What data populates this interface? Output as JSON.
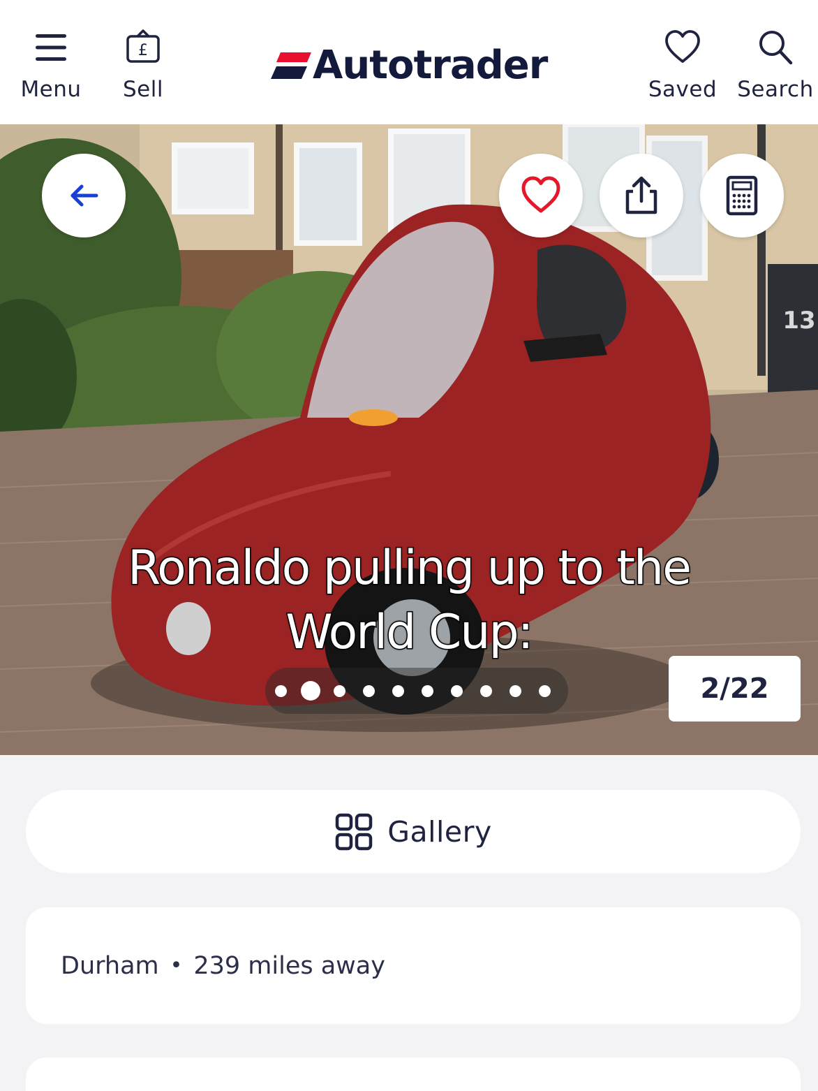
{
  "header": {
    "menu_label": "Menu",
    "sell_label": "Sell",
    "logo_text": "Autotrader",
    "saved_label": "Saved",
    "search_label": "Search",
    "icons": {
      "menu": "hamburger-menu-icon",
      "sell": "pound-tag-icon",
      "saved": "heart-outline-icon",
      "search": "magnifier-icon"
    },
    "logo_color": "#e8102e"
  },
  "hero": {
    "caption": "Ronaldo pulling up to the World Cup:",
    "counter": "2/22",
    "carousel_dots": 10,
    "active_dot": 2,
    "buttons": {
      "back": "arrow-left-icon",
      "favourite": "heart-icon",
      "share": "share-icon",
      "finance": "calculator-icon"
    },
    "bin_number": "13",
    "accent_back": "#1a3fd6",
    "accent_fav": "#e3192b"
  },
  "gallery": {
    "label": "Gallery",
    "icon": "grid-icon"
  },
  "location": {
    "town": "Durham",
    "separator": "•",
    "distance": "239 miles away"
  }
}
